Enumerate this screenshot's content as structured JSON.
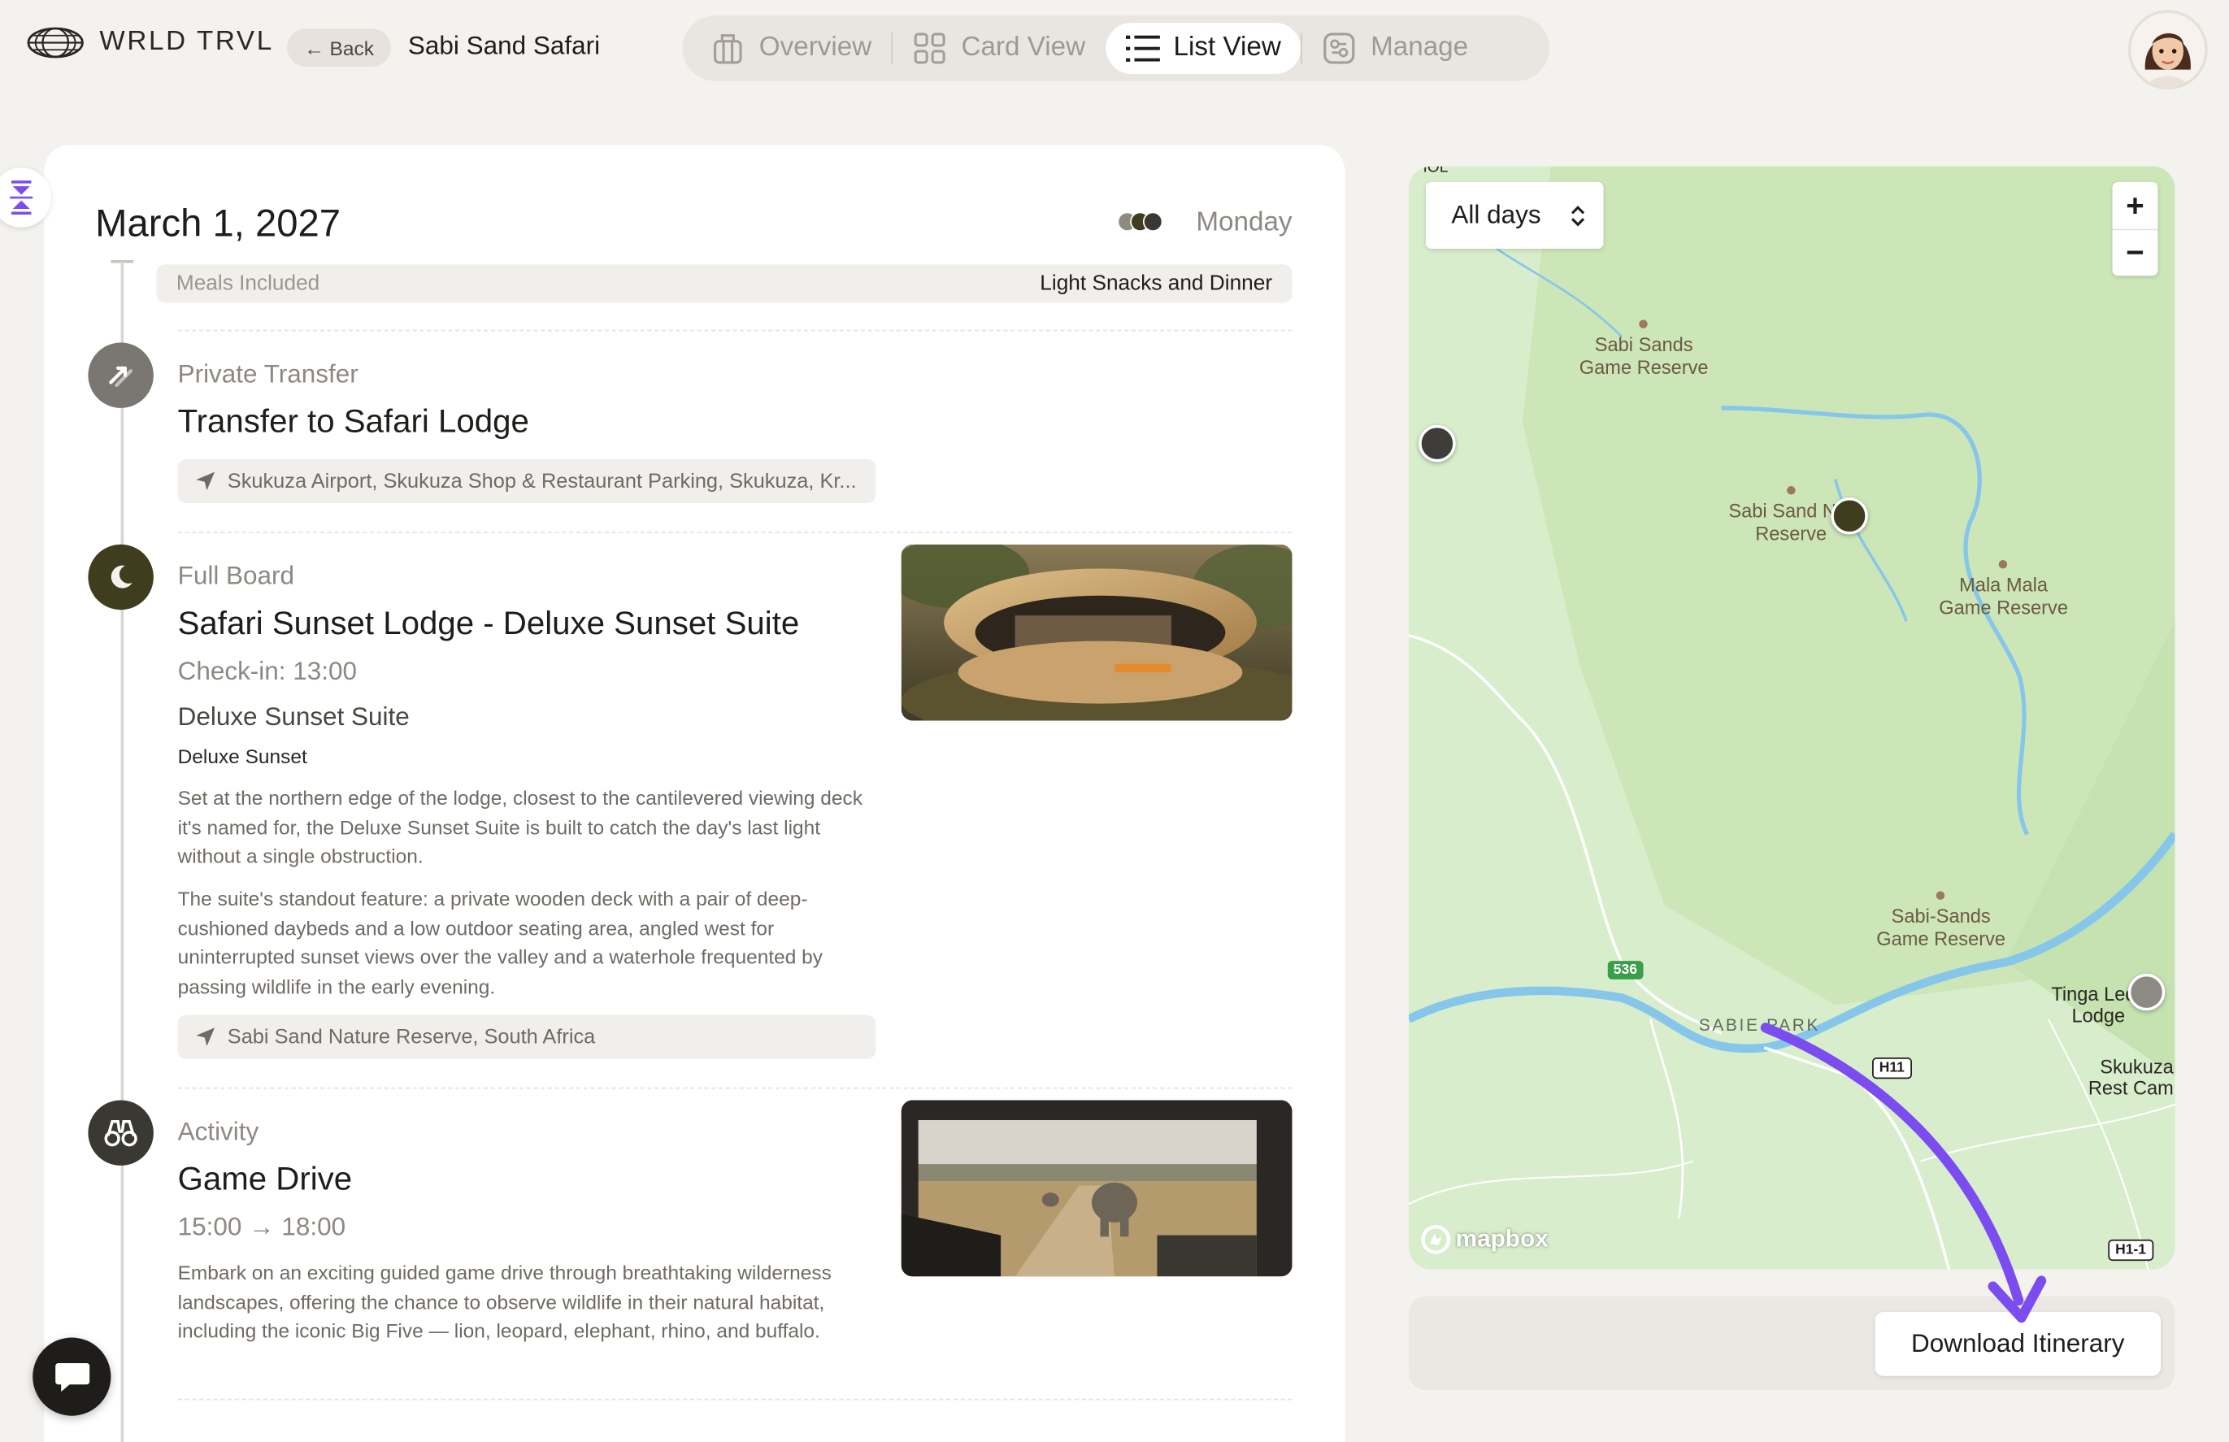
{
  "app": {
    "brand": "WRLD TRVL",
    "back_label": "← Back",
    "trip_title": "Sabi Sand Safari"
  },
  "tabs": [
    {
      "label": "Overview",
      "icon": "luggage-icon",
      "active": false
    },
    {
      "label": "Card View",
      "icon": "grid-icon",
      "active": false
    },
    {
      "label": "List View",
      "icon": "list-icon",
      "active": true
    },
    {
      "label": "Manage",
      "icon": "manage-icon",
      "active": false
    }
  ],
  "day": {
    "date": "March 1, 2027",
    "weekday": "Monday",
    "dot_colors": [
      "#8d8a80",
      "#3f3d1e",
      "#3a3832"
    ],
    "meals_label": "Meals Included",
    "meals_value": "Light Snacks and Dinner"
  },
  "items": [
    {
      "category": "Private Transfer",
      "title": "Transfer to Safari Lodge",
      "location": "Skukuza Airport, Skukuza Shop & Restaurant Parking, Skukuza, Kr...",
      "icon": "transfer-icon",
      "icon_color": "#7a7772"
    },
    {
      "category": "Full Board",
      "title": "Safari Sunset Lodge - Deluxe Sunset Suite",
      "checkin": "Check-in: 13:00",
      "room": "Deluxe Sunset Suite",
      "room_type": "Deluxe Sunset",
      "para1": "Set at the northern edge of the lodge, closest to the cantilevered viewing deck it's named for, the Deluxe Sunset Suite is built to catch the day's last light without a single obstruction.",
      "para2": "The suite's standout feature: a private wooden deck with a pair of deep-cushioned daybeds and a low outdoor seating area, angled west for uninterrupted sunset views over the valley and a waterhole frequented by passing wildlife in the early evening.",
      "location": "Sabi Sand Nature Reserve, South Africa",
      "icon": "moon-bed-icon",
      "icon_color": "#3f3d1e"
    },
    {
      "category": "Activity",
      "title": "Game Drive",
      "time": "15:00 → 18:00",
      "para1": "Embark on an exciting guided game drive through breathtaking wilderness landscapes, offering the chance to observe wildlife in their natural habitat, including the iconic Big Five — lion, leopard, elephant, rhino, and buffalo.",
      "icon": "binoculars-icon",
      "icon_color": "#3a3832"
    }
  ],
  "map": {
    "days_select": "All days",
    "zoom_in": "+",
    "zoom_out": "−",
    "top_cut_label": "IOL",
    "pois": [
      {
        "name_line1": "Sabi Sands",
        "name_line2": "Game Reserve"
      },
      {
        "name_line1": "Sabi Sand N",
        "name_line2": "Reserve",
        "suffix": "re"
      },
      {
        "name_line1": "Mala Mala",
        "name_line2": "Game Reserve"
      },
      {
        "name_line1": "Sabi-Sands",
        "name_line2": "Game Reserve"
      }
    ],
    "labels": {
      "tinga_line1": "Tinga Le",
      "tinga_suffix": "ds",
      "tinga_line2": "Lodge",
      "skukuza_line1": "Skukuza",
      "skukuza_line2": "Rest Cam",
      "sabie_park": "SABIE PARK",
      "road_536": "536",
      "road_h11": "H11",
      "road_h11_1": "H1-1",
      "attribution": "mapbox"
    },
    "colors": {
      "land": "#d6ecc9",
      "reserve": "#c9e4b4",
      "water": "#7cc3ea",
      "road": "#ffffff"
    }
  },
  "download_label": "Download Itinerary",
  "accent_color": "#7b4cf0"
}
